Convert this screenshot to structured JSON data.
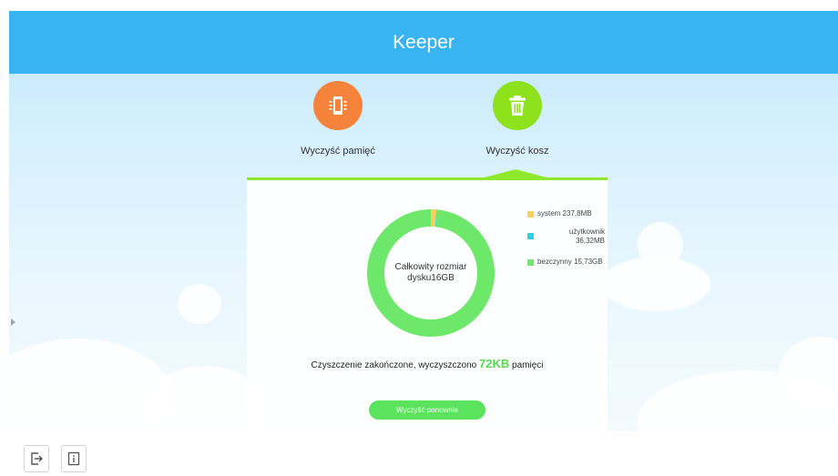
{
  "app": {
    "title": "Keeper"
  },
  "modes": [
    {
      "label": "Wyczyść pamięć",
      "icon": "phone-icon",
      "color": "#f6833b"
    },
    {
      "label": "Wyczyść kosz",
      "icon": "trash-icon",
      "color": "#8de21b"
    }
  ],
  "disk": {
    "center_label": "Całkowity rozmiar dysku16GB",
    "legend": [
      {
        "label": "system 237,8MB",
        "color": "#f5d25a"
      },
      {
        "label": "użytkownik 36,32MB",
        "color": "#2ad2e8"
      },
      {
        "label": "bezczynny 15,73GB",
        "color": "#6de86a"
      }
    ]
  },
  "chart_data": {
    "type": "pie",
    "categories": [
      "system",
      "użytkownik",
      "bezczynny"
    ],
    "values": [
      237.8,
      36.32,
      16107.52
    ],
    "units": [
      "MB",
      "MB",
      "MB"
    ],
    "colors": [
      "#f5d25a",
      "#2ad2e8",
      "#6de86a"
    ],
    "title": "Całkowity rozmiar dysku16GB"
  },
  "status": {
    "prefix": "Czyszczenie zakończone, wyczyszczono ",
    "amount": "72KB",
    "suffix": " pamięci"
  },
  "action_button": "Wyczyść ponownie",
  "bottom_icons": [
    "exit-icon",
    "info-icon"
  ]
}
